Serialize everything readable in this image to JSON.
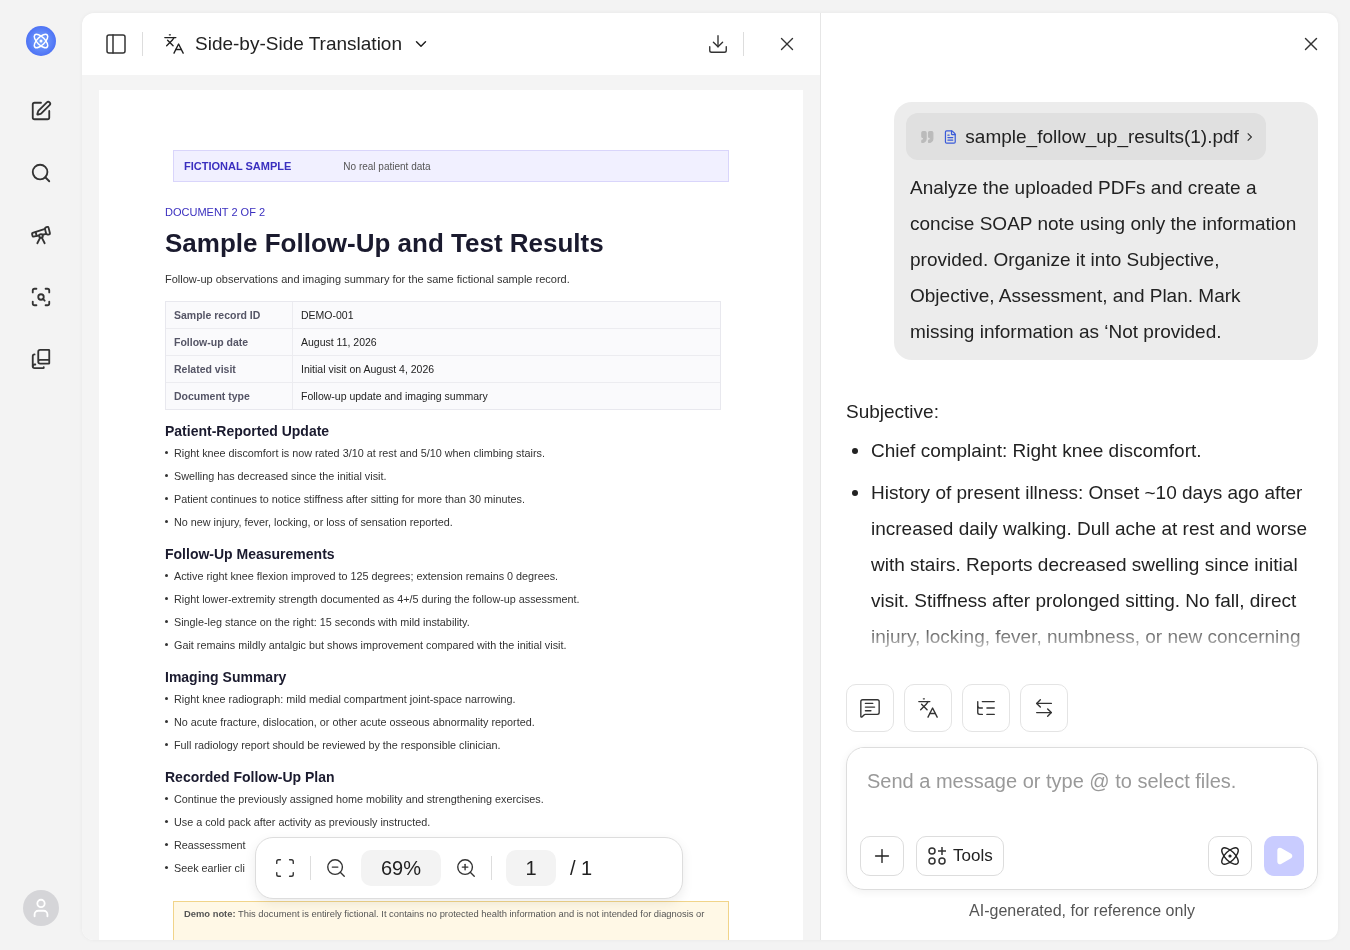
{
  "viewer": {
    "title": "Side-by-Side Translation",
    "document": {
      "banner_label": "FICTIONAL SAMPLE",
      "banner_text": "No real patient data",
      "eyebrow": "DOCUMENT 2 OF 2",
      "title": "Sample Follow-Up and Test Results",
      "subtitle": "Follow-up observations and imaging summary for the same fictional sample record.",
      "table": [
        {
          "label": "Sample record ID",
          "value": "DEMO-001"
        },
        {
          "label": "Follow-up date",
          "value": "August 11, 2026"
        },
        {
          "label": "Related visit",
          "value": "Initial visit on August 4, 2026"
        },
        {
          "label": "Document type",
          "value": "Follow-up update and imaging summary"
        }
      ],
      "sections": [
        {
          "heading": "Patient-Reported Update",
          "bullets": [
            "Right knee discomfort is now rated 3/10 at rest and 5/10 when climbing stairs.",
            "Swelling has decreased since the initial visit.",
            "Patient continues to notice stiffness after sitting for more than 30 minutes.",
            "No new injury, fever, locking, or loss of sensation reported."
          ]
        },
        {
          "heading": "Follow-Up Measurements",
          "bullets": [
            "Active right knee flexion improved to 125 degrees; extension remains 0 degrees.",
            "Right lower-extremity strength documented as 4+/5 during the follow-up assessment.",
            "Single-leg stance on the right: 15 seconds with mild instability.",
            "Gait remains mildly antalgic but shows improvement compared with the initial visit."
          ]
        },
        {
          "heading": "Imaging Summary",
          "bullets": [
            "Right knee radiograph: mild medial compartment joint-space narrowing.",
            "No acute fracture, dislocation, or other acute osseous abnormality reported.",
            "Full radiology report should be reviewed by the responsible clinician."
          ]
        },
        {
          "heading": "Recorded Follow-Up Plan",
          "bullets": [
            "Continue the previously assigned home mobility and strengthening exercises.",
            "Use a cold pack after activity as previously instructed.",
            "Reassessment",
            "Seek earlier cli"
          ]
        }
      ],
      "note": "**Demo note:** This document is entirely fictional. It contains no protected health information and is not intended for diagnosis or"
    },
    "zoom_bar": {
      "zoom": "69%",
      "page": "1",
      "total": "/ 1"
    }
  },
  "chat": {
    "attachment": "sample_follow_up_results(1).pdf",
    "prompt": "Analyze the uploaded PDFs and create a concise SOAP note using only the information provided. Organize it into Subjective, Objective, Assessment, and Plan. Mark missing information as  ‘Not provided.",
    "response": {
      "heading": "Subjective:",
      "bullets": [
        "Chief complaint: Right knee discomfort.",
        "History of present illness: Onset ~10 days ago after increased daily walking. Dull ache at rest and worse with stairs. Reports decreased swelling since initial visit. Stiffness after prolonged sitting. No fall, direct injury, locking, fever, numbness, or new concerning"
      ]
    },
    "input": {
      "placeholder": "Send a message or type @ to select files.",
      "tools_label": "Tools"
    },
    "disclaimer": "AI-generated, for reference only"
  }
}
